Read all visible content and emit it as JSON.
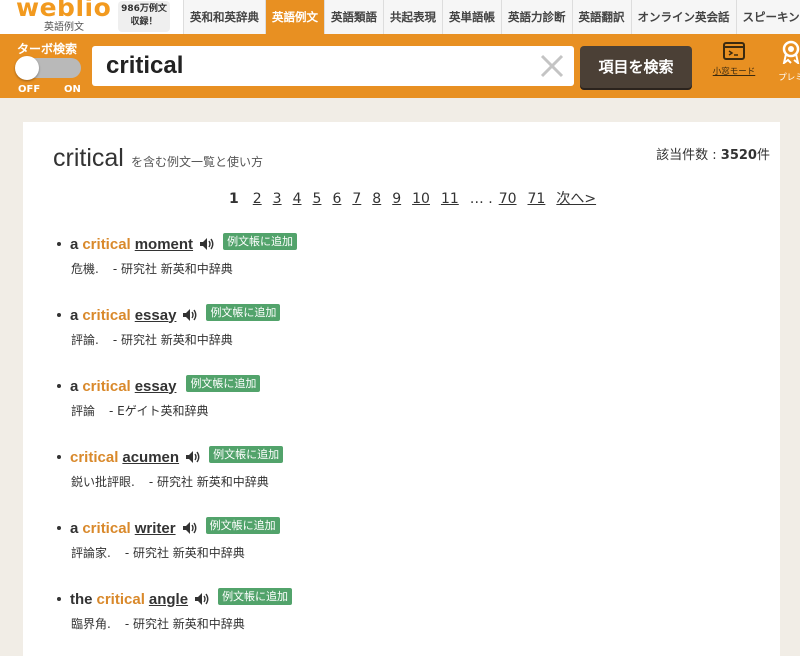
{
  "brand": {
    "logo_text": "weblio",
    "logo_sub": "英語例文",
    "count_line1": "986万例文",
    "count_line2": "収録！"
  },
  "nav": {
    "tabs": [
      {
        "label": "英和和英辞典",
        "active": false
      },
      {
        "label": "英語例文",
        "active": true
      },
      {
        "label": "英語類語",
        "active": false
      },
      {
        "label": "共起表現",
        "active": false
      },
      {
        "label": "英単語帳",
        "active": false
      },
      {
        "label": "英語力診断",
        "active": false
      },
      {
        "label": "英語翻訳",
        "active": false
      },
      {
        "label": "オンライン英会話",
        "active": false
      },
      {
        "label": "スピーキングテ",
        "active": false
      }
    ]
  },
  "search": {
    "turbo_label": "ターボ検索",
    "toggle_off": "OFF",
    "toggle_on": "ON",
    "query": "critical",
    "button_label": "項目を検索",
    "window_mode_label": "小窓モード",
    "premium_label": "プレミ"
  },
  "results": {
    "heading_word": "critical",
    "heading_sub": "を含む例文一覧と使い方",
    "hits_label": "該当件数 : ",
    "hits_count": "3520",
    "hits_unit": "件",
    "add_label": "例文帳に追加",
    "entries": [
      {
        "w1": "a",
        "w2": "critical",
        "w3": "moment",
        "meaning": "危機.",
        "source": "- 研究社 新英和中辞典"
      },
      {
        "w1": "a",
        "w2": "critical",
        "w3": "essay",
        "meaning": "評論.",
        "source": "- 研究社 新英和中辞典"
      },
      {
        "w1": "a",
        "w2": "critical",
        "w3": "essay",
        "meaning": "評論",
        "source": "- Eゲイト英和辞典"
      },
      {
        "w1": "critical",
        "w2": "acumen",
        "meaning": "鋭い批評眼.",
        "source": "- 研究社 新英和中辞典"
      },
      {
        "w1": "a",
        "w2": "critical",
        "w3": "writer",
        "meaning": "評論家.",
        "source": "- 研究社 新英和中辞典"
      },
      {
        "w1": "the",
        "w2": "critical",
        "w3": "angle",
        "meaning": "臨界角.",
        "source": "- 研究社 新英和中辞典"
      }
    ]
  },
  "pagination": {
    "current": "1",
    "pages": [
      "2",
      "3",
      "4",
      "5",
      "6",
      "7",
      "8",
      "9",
      "10",
      "11"
    ],
    "ellipsis": "… .",
    "tail_pages": [
      "70",
      "71"
    ],
    "next_label": "次へ>"
  },
  "colors": {
    "brand_orange": "#e89022",
    "highlight": "#d9892b",
    "add_green": "#52a36b",
    "button_dark": "#4b4036"
  }
}
